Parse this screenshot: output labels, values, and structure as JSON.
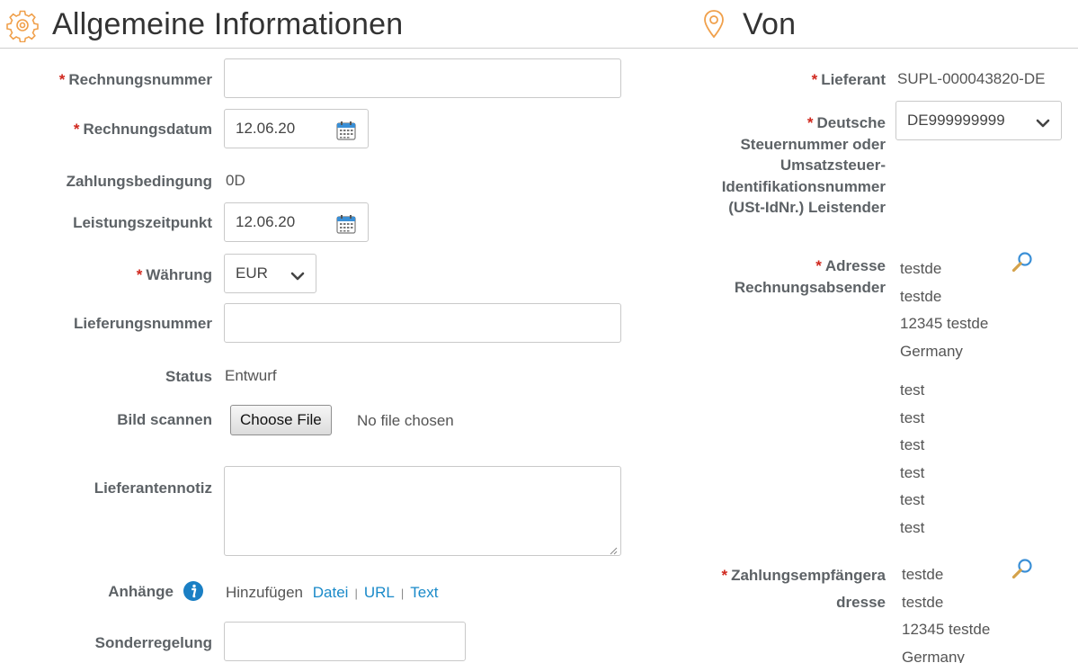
{
  "left_section": {
    "title": "Allgemeine Informationen",
    "icon": "gear-icon",
    "fields": {
      "invoice_number": {
        "label": "Rechnungsnummer",
        "required": true,
        "value": ""
      },
      "invoice_date": {
        "label": "Rechnungsdatum",
        "required": true,
        "value": "12.06.20",
        "icon": "calendar-icon"
      },
      "payment_terms": {
        "label": "Zahlungsbedingung",
        "value": "0D"
      },
      "service_date": {
        "label": "Leistungszeitpunkt",
        "value": "12.06.20",
        "icon": "calendar-icon"
      },
      "currency": {
        "label": "Währung",
        "required": true,
        "value": "EUR"
      },
      "delivery_number": {
        "label": "Lieferungsnummer",
        "value": ""
      },
      "status": {
        "label": "Status",
        "value": "Entwurf"
      },
      "scan_image": {
        "label": "Bild scannen",
        "button": "Choose File",
        "file_text": "No file chosen"
      },
      "supplier_note": {
        "label": "Lieferantennotiz",
        "value": ""
      },
      "attachments": {
        "label": "Anhänge",
        "info_icon": "info-icon",
        "add_text": "Hinzufügen",
        "links": [
          "Datei",
          "URL",
          "Text"
        ],
        "separator": "|"
      },
      "special_rule": {
        "label": "Sonderregelung",
        "value": ""
      }
    }
  },
  "right_section": {
    "title": "Von",
    "icon": "map-pin-icon",
    "fields": {
      "supplier": {
        "label": "Lieferant",
        "required": true,
        "value": "SUPL-000043820-DE"
      },
      "tax_id": {
        "label_lines": [
          "Deutsche",
          "Steuernummer oder",
          "Umsatzsteuer-",
          "Identifikationsnummer",
          "(USt-IdNr.) Leistender"
        ],
        "required": true,
        "value": "DE999999999"
      },
      "sender_address": {
        "label_lines": [
          "Adresse",
          "Rechnungsabsender"
        ],
        "required": true,
        "lines": [
          "testde",
          "testde",
          "12345 testde",
          "Germany"
        ],
        "extra_lines": [
          "test",
          "test",
          "test",
          "test",
          "test",
          "test"
        ],
        "icon": "search-icon"
      },
      "payee_address": {
        "label_lines": [
          "Zahlungsempfängera",
          "dresse"
        ],
        "required": true,
        "lines": [
          "testde",
          "testde",
          "12345 testde",
          "Germany"
        ],
        "icon": "search-icon"
      }
    }
  },
  "colors": {
    "required": "#d0271d",
    "link": "#1a8ac9",
    "icon_orange": "#f0a04b",
    "label": "#5d6266"
  },
  "required_marker": "*"
}
